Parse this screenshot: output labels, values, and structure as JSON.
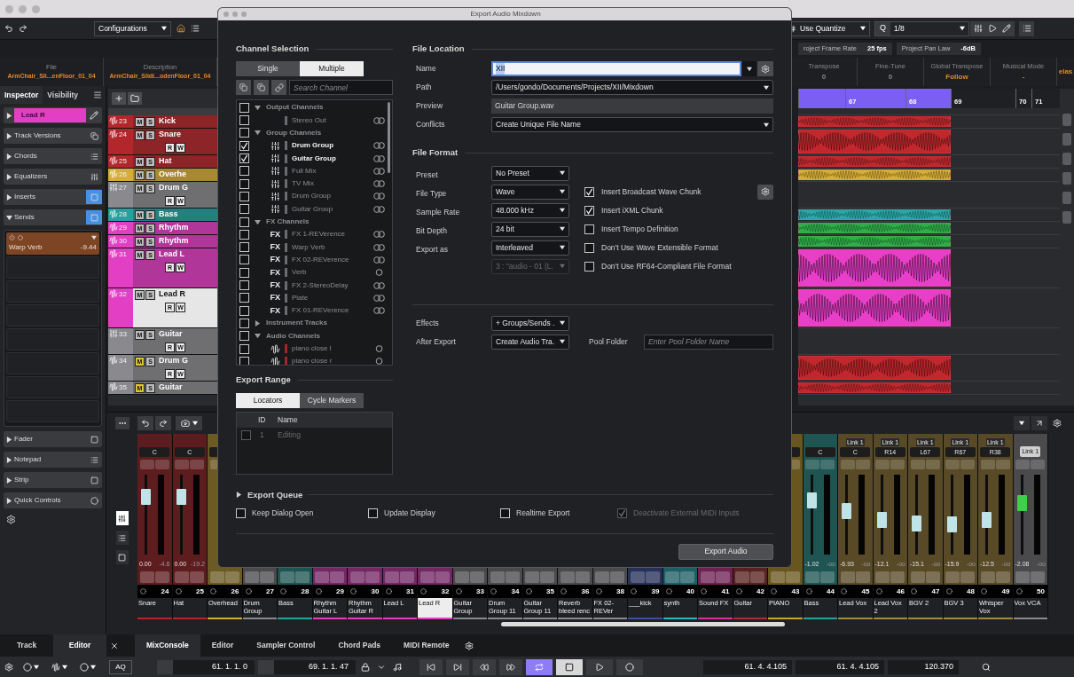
{
  "toolbar": {
    "configurations": "Configurations",
    "quantize_mode": "Use Quantize",
    "quantize_label": "Q",
    "quantize_value": "1/8"
  },
  "project_setup": [
    {
      "label": "roject Frame Rate",
      "value": "25 fps"
    },
    {
      "label": "Project Pan Law",
      "value": "-6dB"
    }
  ],
  "info_line": {
    "left": [
      {
        "label": "File",
        "value": "ArmChair_Sli...enFloor_01_04"
      },
      {
        "label": "Description",
        "value": "ArmChair_Slidi...odenFloor_01_04"
      }
    ],
    "right": [
      {
        "label": "Transpose",
        "value": "0"
      },
      {
        "label": "Fine-Tune",
        "value": "0"
      },
      {
        "label": "Global Transpose",
        "value": "Follow"
      },
      {
        "label": "Musical Mode",
        "value": "-"
      },
      {
        "value": "elas"
      }
    ]
  },
  "inspector": {
    "tabs": [
      {
        "label": "Inspector",
        "selected": true
      },
      {
        "label": "Visibility",
        "selected": false
      }
    ],
    "track": {
      "name": "Lead R",
      "color": "#e23fc4"
    },
    "sections": [
      {
        "label": "Track Versions",
        "expanded": false,
        "active": false
      },
      {
        "label": "Chords",
        "expanded": false,
        "active": false
      },
      {
        "label": "Equalizers",
        "expanded": false,
        "active": false
      },
      {
        "label": "Inserts",
        "expanded": false,
        "active": true
      },
      {
        "label": "Sends",
        "expanded": true,
        "active": true
      },
      {
        "label": "Fader",
        "expanded": false,
        "active": false
      },
      {
        "label": "Notepad",
        "expanded": false,
        "active": false
      },
      {
        "label": "Strip",
        "expanded": false,
        "active": false
      },
      {
        "label": "Quick Controls",
        "expanded": false,
        "active": false
      }
    ],
    "sends": [
      {
        "name": "Warp Verb",
        "value": "-9.44"
      }
    ]
  },
  "tracks": [
    {
      "number": "23",
      "name": "Kick",
      "kind": "audio",
      "color": "#b3262b",
      "tall": false,
      "muted": false,
      "selected": false,
      "ms": [
        "M",
        "S"
      ],
      "event": {
        "color": "#c0282d"
      }
    },
    {
      "number": "24",
      "name": "Snare",
      "kind": "audio",
      "color": "#b3262b",
      "tall": false,
      "muted": false,
      "selected": false,
      "ms": [
        "M",
        "S"
      ],
      "rw": [
        "R",
        "W"
      ],
      "event": {
        "color": "#c0282d"
      }
    },
    {
      "number": "25",
      "name": "Hat",
      "kind": "audio",
      "color": "#b3262b",
      "tall": false,
      "muted": false,
      "selected": false,
      "ms": [
        "M",
        "S"
      ],
      "event": {
        "color": "#c0282d"
      }
    },
    {
      "number": "26",
      "name": "Overhe",
      "kind": "audio",
      "color": "#d6ad38",
      "tall": false,
      "muted": false,
      "selected": false,
      "ms": [
        "M",
        "S"
      ],
      "event": {
        "color": "#d6ad38"
      }
    },
    {
      "number": "27",
      "name": "Drum G",
      "kind": "group",
      "color": "#8a8a8e",
      "tall": false,
      "muted": false,
      "selected": false,
      "ms": [
        "M",
        "S"
      ],
      "rw": [
        "R",
        "W"
      ]
    },
    {
      "number": "28",
      "name": "Bass",
      "kind": "audio",
      "color": "#27a19e",
      "tall": false,
      "muted": false,
      "selected": false,
      "ms": [
        "M",
        "S"
      ],
      "event": {
        "color": "#2aa8a8"
      }
    },
    {
      "number": "29",
      "name": "Rhythm",
      "kind": "audio",
      "color": "#e23fc4",
      "tall": false,
      "muted": false,
      "selected": false,
      "ms": [
        "M",
        "S"
      ],
      "event": {
        "color": "#2fae4a"
      }
    },
    {
      "number": "30",
      "name": "Rhythm",
      "kind": "audio",
      "color": "#e23fc4",
      "tall": false,
      "muted": false,
      "selected": false,
      "ms": [
        "M",
        "S"
      ],
      "event": {
        "color": "#2fae4a"
      }
    },
    {
      "number": "31",
      "name": "Lead L",
      "kind": "audio",
      "color": "#e23fc4",
      "tall": true,
      "muted": false,
      "selected": false,
      "ms": [
        "M",
        "S"
      ],
      "rw": [
        "R",
        "W"
      ],
      "event": {
        "color": "#e83ec8"
      }
    },
    {
      "number": "32",
      "name": "Lead R",
      "kind": "audio",
      "color": "#e23fc4",
      "tall": true,
      "muted": false,
      "selected": true,
      "ms": [
        "M",
        "S"
      ],
      "rw": [
        "R",
        "W"
      ],
      "event": {
        "color": "#e83ec8"
      }
    },
    {
      "number": "33",
      "name": "Guitar",
      "kind": "group",
      "color": "#8a8a8e",
      "tall": false,
      "muted": false,
      "selected": false,
      "ms": [
        "M",
        "S"
      ],
      "rw": [
        "R",
        "W"
      ]
    },
    {
      "number": "34",
      "name": "Drum G",
      "kind": "audio",
      "color": "#8a8a8e",
      "tall": false,
      "muted": true,
      "selected": false,
      "ms": [
        "M",
        "S"
      ],
      "rw": [
        "R",
        "W"
      ],
      "event": {
        "color": "#c0282d"
      }
    },
    {
      "number": "35",
      "name": "Guitar",
      "kind": "audio",
      "color": "#8a8a8e",
      "tall": false,
      "muted": true,
      "selected": false,
      "ms": [
        "M",
        "S"
      ],
      "event": {
        "color": "#c0282d"
      }
    }
  ],
  "ruler": [
    "67",
    "68",
    "69",
    "70",
    "71"
  ],
  "mixer": {
    "channels": [
      {
        "number": "24",
        "name": "Snare",
        "color": "#b3262b",
        "kind": "audio",
        "selected": false,
        "pan": "C",
        "value": "0.00",
        "peak": "-4.6",
        "level": 0.78
      },
      {
        "number": "25",
        "name": "Hat",
        "color": "#b3262b",
        "kind": "audio",
        "selected": false,
        "pan": "C",
        "value": "0.00",
        "peak": "-19.2",
        "level": 0.78
      },
      {
        "number": "26",
        "name": "Overhead",
        "color": "#d6ad38",
        "kind": "audio",
        "selected": false
      },
      {
        "number": "27",
        "name": "Drum Group",
        "color": "#8a8a8e",
        "kind": "audio",
        "selected": false
      },
      {
        "number": "28",
        "name": "Bass",
        "color": "#27a19e",
        "kind": "audio",
        "selected": false
      },
      {
        "number": "29",
        "name": "Rhythm Guitar L",
        "color": "#e23fc4",
        "kind": "audio",
        "selected": false
      },
      {
        "number": "30",
        "name": "Rhythm Guitar R",
        "color": "#e23fc4",
        "kind": "audio",
        "selected": false
      },
      {
        "number": "31",
        "name": "Lead L",
        "color": "#e23fc4",
        "kind": "audio",
        "selected": false
      },
      {
        "number": "32",
        "name": "Lead R",
        "color": "#e23fc4",
        "kind": "audio",
        "selected": true
      },
      {
        "number": "33",
        "name": "Guitar Group",
        "color": "#8a8a8e",
        "kind": "audio",
        "selected": false
      },
      {
        "number": "34",
        "name": "Drum Group 11",
        "color": "#8a8a8e",
        "kind": "audio",
        "selected": false
      },
      {
        "number": "35",
        "name": "Guitar Group 11",
        "color": "#8a8a8e",
        "kind": "audio",
        "selected": false
      },
      {
        "number": "36",
        "name": "Reverb bleed renc",
        "color": "#8a8a8e",
        "kind": "audio",
        "selected": false
      },
      {
        "number": "38",
        "name": "FX 02-REVer",
        "color": "#8a8a8e",
        "kind": "audio",
        "selected": false
      },
      {
        "number": "39",
        "name": "___kick",
        "color": "#3b4fa8",
        "kind": "audio",
        "selected": false
      },
      {
        "number": "40",
        "name": "synth",
        "color": "#2bb6c4",
        "kind": "audio",
        "selected": false
      },
      {
        "number": "41",
        "name": "Sound FX",
        "color": "#d9309c",
        "kind": "audio",
        "selected": false
      },
      {
        "number": "42",
        "name": "Guitar",
        "color": "#a8302e",
        "kind": "audio",
        "selected": false
      },
      {
        "number": "43",
        "name": "PIANO",
        "color": "#cfa42a",
        "kind": "audio",
        "selected": false
      },
      {
        "number": "44",
        "name": "Bass",
        "color": "#27a19e",
        "kind": "audio",
        "selected": false,
        "pan": "C",
        "value": "-1.02",
        "peak": "-oo",
        "level": 0.72
      },
      {
        "number": "45",
        "name": "Lead Vox",
        "color": "#a88a3c",
        "kind": "audio",
        "selected": false,
        "link": "Link 1",
        "pan": "C",
        "value": "-6.93",
        "peak": "-oo",
        "level": 0.55
      },
      {
        "number": "46",
        "name": "Lead Vox 2",
        "color": "#a88a3c",
        "kind": "audio",
        "selected": false,
        "link": "Link 1",
        "pan": "R14",
        "value": "-12.1",
        "peak": "-oo",
        "level": 0.42
      },
      {
        "number": "47",
        "name": "BGV 2",
        "color": "#a88a3c",
        "kind": "audio",
        "selected": false,
        "link": "Link 1",
        "pan": "L67",
        "value": "-15.1",
        "peak": "-oo",
        "level": 0.36
      },
      {
        "number": "48",
        "name": "BGV 3",
        "color": "#a88a3c",
        "kind": "audio",
        "selected": false,
        "link": "Link 1",
        "pan": "R67",
        "value": "-15.9",
        "peak": "-oo",
        "level": 0.35
      },
      {
        "number": "49",
        "name": "Whisper Vox",
        "color": "#a88a3c",
        "kind": "audio",
        "selected": false,
        "link": "Link 1",
        "pan": "R38",
        "value": "-12.5",
        "peak": "-oo",
        "level": 0.42
      },
      {
        "number": "50",
        "name": "Vox VCA",
        "color": "#8a8a8e",
        "kind": "vca",
        "selected": false,
        "link": "Link 1",
        "value": "-2.08",
        "peak": "-oo",
        "level": 0.68
      }
    ]
  },
  "bottom_tabs": {
    "left": [
      {
        "label": "Track",
        "selected": false
      },
      {
        "label": "Editor",
        "selected": true
      }
    ],
    "right": [
      {
        "label": "MixConsole",
        "selected": true
      },
      {
        "label": "Editor",
        "selected": false
      },
      {
        "label": "Sampler Control",
        "selected": false
      },
      {
        "label": "Chord Pads",
        "selected": false
      },
      {
        "label": "MIDI Remote",
        "selected": false
      }
    ]
  },
  "transport": {
    "aq": "AQ",
    "left_locator": "61. 1. 1. 0",
    "right_locator": "69. 1. 1. 47",
    "cycle": true,
    "position_primary": "61. 4. 4.105",
    "position_secondary": "61. 4. 4.105",
    "tempo": "120.370"
  },
  "dialog": {
    "title": "Export Audio Mixdown",
    "channel_selection": {
      "heading": "Channel Selection",
      "modes": [
        {
          "label": "Single",
          "selected": false
        },
        {
          "label": "Multiple",
          "selected": true
        }
      ],
      "search_placeholder": "Search Channel",
      "tree": [
        {
          "name": "Output Channels",
          "checked": false,
          "expanded": true,
          "children": [
            {
              "name": "Stereo Out",
              "kind": "output",
              "checked": false,
              "color": "#6c6c70",
              "stereo": true
            }
          ]
        },
        {
          "name": "Group Channels",
          "checked": false,
          "expanded": true,
          "children": [
            {
              "name": "Drum Group",
              "kind": "group",
              "checked": true,
              "color": "#6c6c70",
              "stereo": true
            },
            {
              "name": "Guitar Group",
              "kind": "group",
              "checked": true,
              "color": "#6c6c70",
              "stereo": true
            },
            {
              "name": "Full Mix",
              "kind": "group",
              "checked": false,
              "color": "#6c6c70",
              "stereo": true
            },
            {
              "name": "TV Mix",
              "kind": "group",
              "checked": false,
              "color": "#6c6c70",
              "stereo": true
            },
            {
              "name": "Drum Group",
              "kind": "group",
              "checked": false,
              "color": "#6c6c70",
              "stereo": true
            },
            {
              "name": "Guitar Group",
              "kind": "group",
              "checked": false,
              "color": "#6c6c70",
              "stereo": true
            }
          ]
        },
        {
          "name": "FX Channels",
          "checked": false,
          "expanded": true,
          "children": [
            {
              "name": "FX 1-REVerence",
              "kind": "fx",
              "icon_text": "FX",
              "checked": false,
              "color": "#6c6c70",
              "stereo": true
            },
            {
              "name": "Warp Verb",
              "kind": "fx",
              "icon_text": "FX",
              "checked": false,
              "color": "#6c6c70",
              "stereo": true
            },
            {
              "name": "FX 02-REVerence",
              "kind": "fx",
              "icon_text": "FX",
              "checked": false,
              "color": "#6c6c70",
              "stereo": true
            },
            {
              "name": "Verb",
              "kind": "fx",
              "icon_text": "FX",
              "checked": false,
              "color": "#6c6c70",
              "stereo": false
            },
            {
              "name": "FX 2-StereoDelay",
              "kind": "fx",
              "icon_text": "FX",
              "checked": false,
              "color": "#6c6c70",
              "stereo": true
            },
            {
              "name": "Plate",
              "kind": "fx",
              "icon_text": "FX",
              "checked": false,
              "color": "#6c6c70",
              "stereo": true
            },
            {
              "name": "FX 01-REVerence",
              "kind": "fx",
              "icon_text": "FX",
              "checked": false,
              "color": "#6c6c70",
              "stereo": true
            }
          ]
        },
        {
          "name": "Instrument Tracks",
          "checked": false,
          "expanded": false
        },
        {
          "name": "Audio Channels",
          "checked": false,
          "expanded": true,
          "children": [
            {
              "name": "piano close l",
              "kind": "audio",
              "checked": false,
              "color": "#a3262a",
              "stereo": false
            },
            {
              "name": "piano close r",
              "kind": "audio",
              "checked": false,
              "color": "#a3262a",
              "stereo": false
            }
          ]
        }
      ]
    },
    "export_range": {
      "heading": "Export Range",
      "tabs": [
        {
          "label": "Locators",
          "selected": true
        },
        {
          "label": "Cycle Markers",
          "selected": false
        }
      ],
      "columns": [
        "ID",
        "Name"
      ],
      "rows": [
        {
          "id": "1",
          "name": "Editing",
          "checked": false
        }
      ]
    },
    "file_location": {
      "heading": "File Location",
      "fields": [
        {
          "label": "Name",
          "value": "XII",
          "kind": "name"
        },
        {
          "label": "Path",
          "value": "/Users/gondo/Documents/Projects/XII/Mixdown",
          "kind": "dropdown"
        },
        {
          "label": "Preview",
          "value": "Guitar Group.wav",
          "kind": "readonly"
        },
        {
          "label": "Conflicts",
          "value": "Create Unique File Name",
          "kind": "dropdown"
        }
      ]
    },
    "file_format": {
      "heading": "File Format",
      "fields": [
        {
          "label": "Preset",
          "value": "No Preset",
          "disabled": false
        },
        {
          "label": "File Type",
          "value": "Wave",
          "disabled": false
        },
        {
          "label": "Sample Rate",
          "value": "48.000 kHz",
          "disabled": false
        },
        {
          "label": "Bit Depth",
          "value": "24 bit",
          "disabled": false
        },
        {
          "label": "Export as",
          "value": "Interleaved",
          "disabled": false
        },
        {
          "value": "3 : \"audio - 01 (L.",
          "disabled": true
        }
      ],
      "checks": [
        {
          "label": "Insert Broadcast Wave Chunk",
          "checked": true
        },
        {
          "label": "Insert iXML Chunk",
          "checked": true
        },
        {
          "label": "Insert Tempo Definition",
          "checked": false
        },
        {
          "label": "Don't Use Wave Extensible Format",
          "checked": false
        },
        {
          "label": "Don't Use RF64-Compliant File Format",
          "checked": false
        }
      ]
    },
    "effects": {
      "label": "Effects",
      "value": "+ Groups/Sends ."
    },
    "after_export": {
      "label": "After Export",
      "value": "Create Audio Tra."
    },
    "pool_folder": {
      "label": "Pool Folder",
      "placeholder": "Enter Pool Folder Name"
    },
    "export_queue": {
      "label": "Export Queue",
      "expanded": false
    },
    "options": [
      {
        "label": "Keep Dialog Open",
        "checked": false,
        "disabled": false
      },
      {
        "label": "Update Display",
        "checked": false,
        "disabled": false
      },
      {
        "label": "Realtime Export",
        "checked": false,
        "disabled": false
      },
      {
        "label": "Deactivate External MIDI Inputs",
        "checked": true,
        "disabled": true
      }
    ],
    "export_button": "Export Audio"
  }
}
